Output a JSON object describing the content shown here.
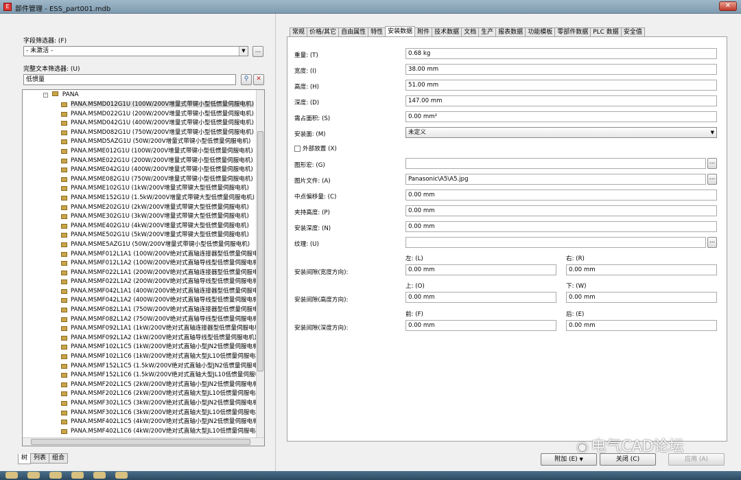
{
  "window": {
    "title": "部件管理 - ESS_part001.mdb",
    "close_glyph": "✕"
  },
  "left": {
    "field_filter_label": "字段筛选器: (F)",
    "field_filter_value": "- 未激活 -",
    "fulltext_filter_label": "完整文本筛选器: (U)",
    "fulltext_value": "低惯量",
    "tree_root": "PANA",
    "tree_items": [
      "PANA.MSMD012G1U (100W/200V增量式带键小型低惯量伺服电机)",
      "PANA.MSMD022G1U (200W/200V增量式带键小型低惯量伺服电机)",
      "PANA.MSMD042G1U (400W/200V增量式带键小型低惯量伺服电机)",
      "PANA.MSMD082G1U (750W/200V增量式带键小型低惯量伺服电机)",
      "PANA.MSMD5AZG1U (50W/200V增量式带键小型低惯量伺服电机)",
      "PANA.MSME012G1U (100W/200V增量式带键小型低惯量伺服电机)",
      "PANA.MSME022G1U (200W/200V增量式带键小型低惯量伺服电机)",
      "PANA.MSME042G1U (400W/200V增量式带键小型低惯量伺服电机)",
      "PANA.MSME082G1U (750W/200V增量式带键小型低惯量伺服电机)",
      "PANA.MSME102G1U (1kW/200V增量式带键大型低惯量伺服电机)",
      "PANA.MSME152G1U (1.5kW/200V增量式带键大型低惯量伺服电机)",
      "PANA.MSME202G1U (2kW/200V增量式带键大型低惯量伺服电机)",
      "PANA.MSME302G1U (3kW/200V增量式带键大型低惯量伺服电机)",
      "PANA.MSME402G1U (4kW/200V增量式带键大型低惯量伺服电机)",
      "PANA.MSME502G1U (5kW/200V增量式带键大型低惯量伺服电机)",
      "PANA.MSME5AZG1U (50W/200V增量式带键小型低惯量伺服电机)",
      "PANA.MSMF012L1A1 (100W/200V绝对式直轴连接器型低惯量伺服电机)",
      "PANA.MSMF012L1A2 (100W/200V绝对式直轴导线型低惯量伺服电机)",
      "PANA.MSMF022L1A1 (200W/200V绝对式直轴连接器型低惯量伺服电机)",
      "PANA.MSMF022L1A2 (200W/200V绝对式直轴导线型低惯量伺服电机)",
      "PANA.MSMF042L1A1 (400W/200V绝对式直轴连接器型低惯量伺服电机)",
      "PANA.MSMF042L1A2 (400W/200V绝对式直轴导线型低惯量伺服电机)",
      "PANA.MSMF082L1A1 (750W/200V绝对式直轴连接器型低惯量伺服电机)",
      "PANA.MSMF082L1A2 (750W/200V绝对式直轴导线型低惯量伺服电机)",
      "PANA.MSMF092L1A1 (1kW/200V绝对式直轴连接器型低惯量伺服电机)",
      "PANA.MSMF092L1A2 (1kW/200V绝对式直轴导线型低惯量伺服电机)",
      "PANA.MSMF102L1C5 (1kW/200V绝对式直轴小型JN2低惯量伺服电机)",
      "PANA.MSMF102L1C6 (1kW/200V绝对式直轴大型JL10低惯量伺服电机)",
      "PANA.MSMF152L1C5 (1.5kW/200V绝对式直轴小型JN2低惯量伺服电机)",
      "PANA.MSMF152L1C6 (1.5kW/200V绝对式直轴大型JL10低惯量伺服电机)",
      "PANA.MSMF202L1C5 (2kW/200V绝对式直轴小型JN2低惯量伺服电机)",
      "PANA.MSMF202L1C6 (2kW/200V绝对式直轴大型JL10低惯量伺服电机)",
      "PANA.MSMF302L1C5 (3kW/200V绝对式直轴小型JN2低惯量伺服电机)",
      "PANA.MSMF302L1C6 (3kW/200V绝对式直轴大型JL10低惯量伺服电机)",
      "PANA.MSMF402L1C5 (4kW/200V绝对式直轴小型JN2低惯量伺服电机)",
      "PANA.MSMF402L1C6 (4kW/200V绝对式直轴大型JL10低惯量伺服电机)"
    ],
    "bottom_tabs": [
      "树",
      "列表",
      "组合"
    ]
  },
  "right": {
    "tabs": [
      "常规",
      "价格/其它",
      "自由属性",
      "特性",
      "安装数据",
      "附件",
      "技术数据",
      "文档",
      "生产",
      "报表数据",
      "功能模板",
      "零部件数据",
      "PLC 数据",
      "安全值"
    ],
    "active_tab": "安装数据",
    "fields": {
      "weight_label": "重量: (T)",
      "weight_value": "0.68 kg",
      "width_label": "宽度: (I)",
      "width_value": "38.00 mm",
      "height_label": "高度: (H)",
      "height_value": "51.00 mm",
      "depth_label": "深度: (D)",
      "depth_value": "147.00 mm",
      "area_label": "需占面积: (S)",
      "area_value": "0.00 mm²",
      "mount_surface_label": "安装面: (M)",
      "mount_surface_value": "未定义",
      "external_label": "外部放置 (X)",
      "graphic_macro_label": "图形宏: (G)",
      "graphic_macro_value": "",
      "image_file_label": "图片文件: (A)",
      "image_file_value": "Panasonic\\A5\\A5.jpg",
      "center_offset_label": "中点偏移量: (C)",
      "center_offset_value": "0.00 mm",
      "clamp_height_label": "夹持高度: (P)",
      "clamp_height_value": "0.00 mm",
      "mount_depth_label": "安装深度: (N)",
      "mount_depth_value": "0.00 mm",
      "texture_label": "纹理: (U)",
      "texture_value": ""
    },
    "clearances": {
      "width_label": "安装间隙(宽度方向):",
      "left_label": "左: (L)",
      "left_value": "0.00 mm",
      "right_label": "右: (R)",
      "right_value": "0.00 mm",
      "height_label": "安装间隙(高度方向):",
      "top_label": "上: (O)",
      "top_value": "0.00 mm",
      "bottom_label": "下: (W)",
      "bottom_value": "0.00 mm",
      "depth_label": "安装间隙(深度方向):",
      "front_label": "前: (F)",
      "front_value": "0.00 mm",
      "back_label": "后: (E)",
      "back_value": "0.00 mm"
    },
    "buttons": {
      "extra": "附加 (E)",
      "close": "关闭 (C)",
      "apply": "应用 (A)"
    }
  },
  "watermark": "电气CAD论坛",
  "browse_glyph": "...",
  "dropdown_glyph": "▼"
}
